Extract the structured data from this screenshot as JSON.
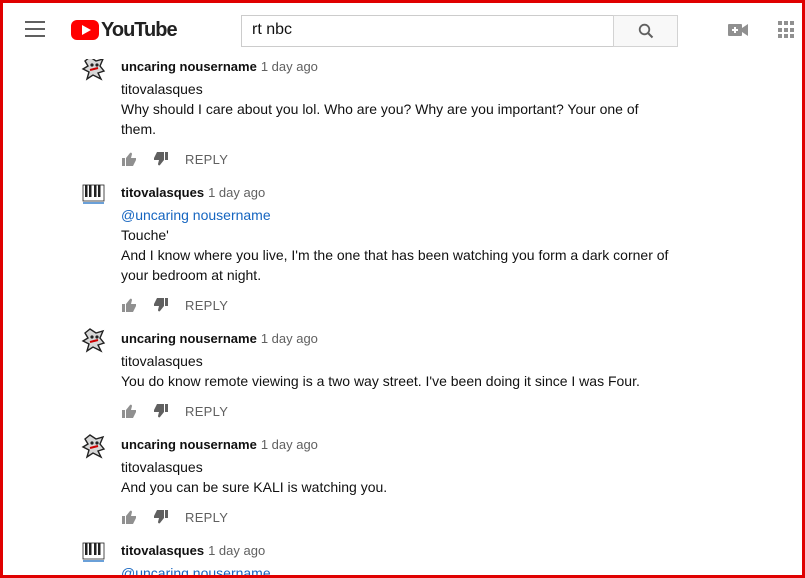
{
  "header": {
    "logo_text": "YouTube",
    "search_value": "rt nbc"
  },
  "comments": [
    {
      "author": "uncaring nousername",
      "time": "1 day ago",
      "lines": [
        "titovalasques",
        "Why should I care about you lol. Who are you? Why are you important? Your one of",
        "them."
      ],
      "reply_label": "REPLY"
    },
    {
      "author": "titovalasques",
      "time": "1 day ago",
      "mention": "@uncaring nousername",
      "lines": [
        "Touche'",
        "And I know where you live, I'm the one that has been watching you form a dark corner of",
        "your bedroom at night."
      ],
      "reply_label": "REPLY"
    },
    {
      "author": "uncaring nousername",
      "time": "1 day ago",
      "lines": [
        "titovalasques",
        "You do know remote viewing is a two way street. I've been doing it since I was Four."
      ],
      "reply_label": "REPLY"
    },
    {
      "author": "uncaring nousername",
      "time": "1 day ago",
      "lines": [
        "titovalasques",
        "And you can be sure KALI is watching you."
      ],
      "reply_label": "REPLY"
    },
    {
      "author": "titovalasques",
      "time": "1 day ago",
      "mention": "@uncaring nousername"
    }
  ]
}
